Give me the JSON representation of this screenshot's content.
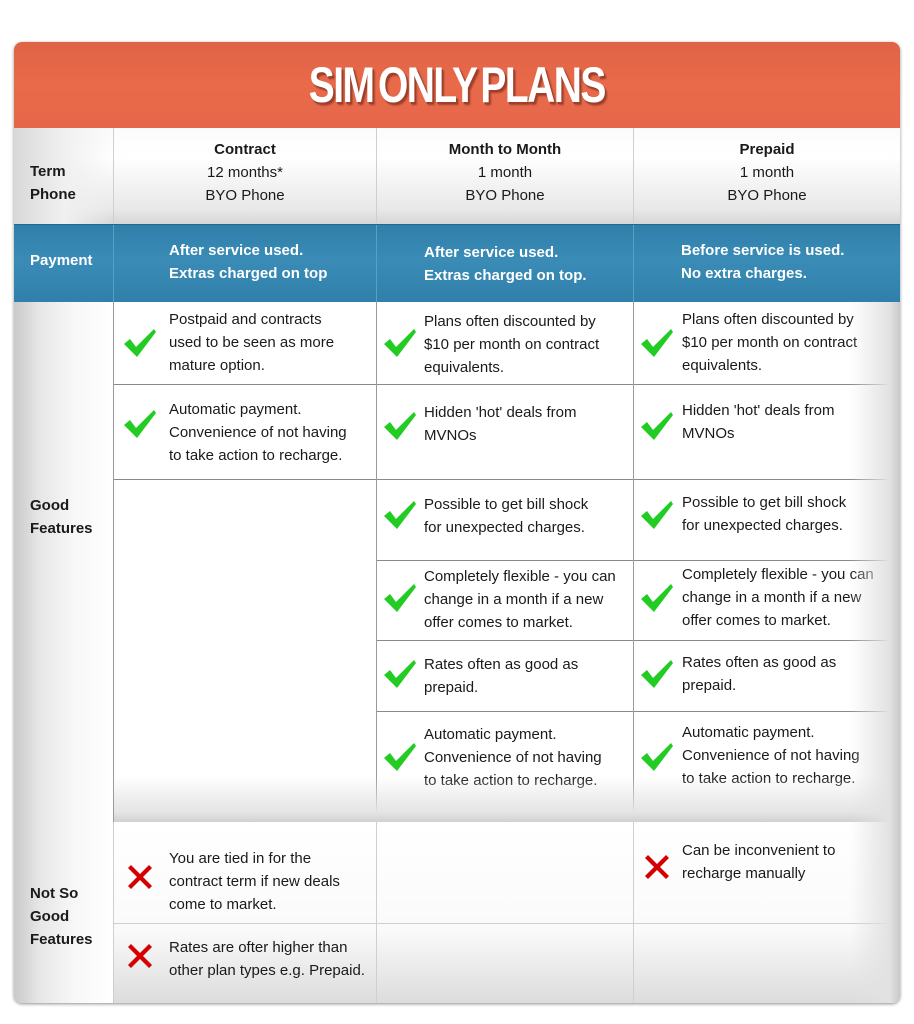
{
  "title": "SIM ONLY PLANS",
  "colors": {
    "banner": "#e96a4a",
    "payment_band": "#3a8cb7",
    "check": "#22cc22",
    "cross": "#d40000"
  },
  "row_labels": {
    "term": "Term",
    "phone": "Phone",
    "payment": "Payment",
    "good_line1": "Good",
    "good_line2": "Features",
    "bad_line1": "Not So",
    "bad_line2": "Good",
    "bad_line3": "Features"
  },
  "plans": [
    {
      "name": "Contract",
      "term": "12 months*",
      "phone": "BYO Phone",
      "payment_line1": "After service used.",
      "payment_line2": "Extras charged on top"
    },
    {
      "name": "Month to Month",
      "term": "1 month",
      "phone": "BYO Phone",
      "payment_line1": "After service used.",
      "payment_line2": "Extras charged on top."
    },
    {
      "name": "Prepaid",
      "term": "1 month",
      "phone": "BYO Phone",
      "payment_line1": "Before service is used.",
      "payment_line2": "No extra charges."
    }
  ],
  "good_features": {
    "contract": [
      {
        "icon": "check-icon",
        "lines": [
          "Postpaid and contracts",
          "used to be seen as more",
          "mature option."
        ]
      },
      {
        "icon": "check-icon",
        "lines": [
          "Automatic payment.",
          "Convenience of not having",
          "to take action to  recharge."
        ]
      }
    ],
    "month_to_month": [
      {
        "icon": "check-icon",
        "lines": [
          "Plans often discounted by",
          "$10 per month on contract",
          "equivalents."
        ]
      },
      {
        "icon": "check-icon",
        "lines": [
          "Hidden 'hot' deals from",
          "MVNOs"
        ]
      },
      {
        "icon": "check-icon",
        "lines": [
          "Possible to get bill shock",
          "for unexpected charges."
        ]
      },
      {
        "icon": "check-icon",
        "lines": [
          "Completely flexible - you can",
          "change in a month if a new",
          "offer comes to market."
        ]
      },
      {
        "icon": "check-icon",
        "lines": [
          "Rates often as good as",
          "prepaid."
        ]
      },
      {
        "icon": "check-icon",
        "lines": [
          "Automatic payment.",
          "Convenience of not having",
          "to take action to  recharge."
        ]
      }
    ],
    "prepaid": [
      {
        "icon": "check-icon",
        "lines": [
          "Plans often discounted by",
          "$10 per month on contract",
          "equivalents."
        ]
      },
      {
        "icon": "check-icon",
        "lines": [
          "Hidden 'hot' deals from",
          "MVNOs"
        ]
      },
      {
        "icon": "check-icon",
        "lines": [
          "Possible to get bill shock",
          "for unexpected charges."
        ]
      },
      {
        "icon": "check-icon",
        "lines": [
          "Completely flexible - you can",
          "change in a month if a new",
          "offer comes to market."
        ]
      },
      {
        "icon": "check-icon",
        "lines": [
          "Rates often as good as",
          "prepaid."
        ]
      },
      {
        "icon": "check-icon",
        "lines": [
          "Automatic payment.",
          "Convenience of not having",
          "to take action to  recharge."
        ]
      }
    ]
  },
  "bad_features": {
    "contract": [
      {
        "icon": "cross-icon",
        "lines": [
          "You are tied in for the",
          "contract term if new deals",
          "come to market."
        ]
      },
      {
        "icon": "cross-icon",
        "lines": [
          "Rates are ofter higher than",
          "other plan types e.g. Prepaid."
        ]
      }
    ],
    "month_to_month": [],
    "prepaid": [
      {
        "icon": "cross-icon",
        "lines": [
          "Can be inconvenient to",
          "recharge manually"
        ]
      }
    ]
  }
}
